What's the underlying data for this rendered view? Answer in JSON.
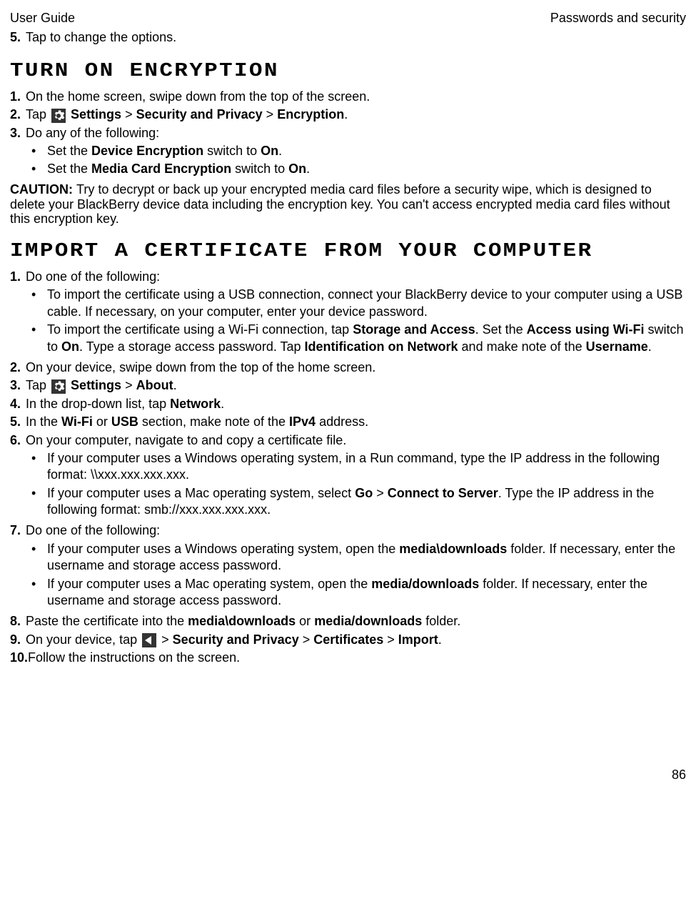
{
  "header_left": "User Guide",
  "header_right": "Passwords and security",
  "intro_step": {
    "num": "5.",
    "text": "Tap to change the options."
  },
  "section1": {
    "title": "Turn on encryption",
    "step1": {
      "num": "1.",
      "text": "On the home screen, swipe down from the top of the screen."
    },
    "step2": {
      "num": "2.",
      "prefix": "Tap ",
      "b1": "Settings",
      "sep1": " > ",
      "b2": "Security and Privacy",
      "sep2": " > ",
      "b3": "Encryption",
      "suffix": "."
    },
    "step3": {
      "num": "3.",
      "text": "Do any of the following:"
    },
    "bullets": {
      "b1": {
        "p1": "Set the ",
        "b1": "Device Encryption",
        "p2": " switch to ",
        "b2": "On",
        "p3": "."
      },
      "b2": {
        "p1": "Set the ",
        "b1": "Media Card Encryption",
        "p2": " switch to ",
        "b2": "On",
        "p3": "."
      }
    },
    "caution_label": "CAUTION: ",
    "caution_text": "Try to decrypt or back up your encrypted media card files before a security wipe, which is designed to delete your BlackBerry device data including the encryption key. You can't access encrypted media card files without this encryption key."
  },
  "section2": {
    "title": "Import a certificate from your computer",
    "step1": {
      "num": "1.",
      "text": "Do one of the following:"
    },
    "s1bullets": {
      "b1": "To import the certificate using a USB connection, connect your BlackBerry device to your computer using a USB cable. If necessary, on your computer, enter your device password.",
      "b2": {
        "p1": "To import the certificate using a Wi-Fi connection, tap ",
        "b1": "Storage and Access",
        "p2": ". Set the ",
        "b2": "Access using Wi-Fi",
        "p3": " switch to ",
        "b3": "On",
        "p4": ". Type a storage access password. Tap ",
        "b4": "Identification on Network",
        "p5": " and make note of the ",
        "b5": "Username",
        "p6": "."
      }
    },
    "step2": {
      "num": "2.",
      "text": "On your device, swipe down from the top of the home screen."
    },
    "step3": {
      "num": "3.",
      "prefix": "Tap ",
      "b1": "Settings",
      "sep1": " > ",
      "b2": "About",
      "suffix": "."
    },
    "step4": {
      "num": "4.",
      "p1": "In the drop-down list, tap ",
      "b1": "Network",
      "p2": "."
    },
    "step5": {
      "num": "5.",
      "p1": "In the ",
      "b1": "Wi-Fi",
      "p2": " or ",
      "b2": "USB",
      "p3": " section, make note of the ",
      "b3": "IPv4",
      "p4": " address."
    },
    "step6": {
      "num": "6.",
      "text": "On your computer, navigate to and copy a certificate file."
    },
    "s6bullets": {
      "b1": "If your computer uses a Windows operating system, in a Run command, type the IP address in the following format: \\\\xxx.xxx.xxx.xxx.",
      "b2": {
        "p1": "If your computer uses a Mac operating system, select ",
        "b1": "Go",
        "p2": " > ",
        "b2": "Connect to Server",
        "p3": ". Type the IP address in the following format: smb://xxx.xxx.xxx.xxx."
      }
    },
    "step7": {
      "num": "7.",
      "text": "Do one of the following:"
    },
    "s7bullets": {
      "b1": {
        "p1": "If your computer uses a Windows operating system, open the ",
        "b1": "media\\downloads",
        "p2": " folder. If necessary, enter the username and storage access password."
      },
      "b2": {
        "p1": "If your computer uses a Mac operating system, open the ",
        "b1": "media/downloads",
        "p2": " folder. If necessary, enter the username and storage access password."
      }
    },
    "step8": {
      "num": "8.",
      "p1": "Paste the certificate into the ",
      "b1": "media\\downloads",
      "p2": " or ",
      "b2": "media/downloads",
      "p3": " folder."
    },
    "step9": {
      "num": "9.",
      "p1": "On your device, tap ",
      "p2": " > ",
      "b1": "Security and Privacy",
      "p3": " > ",
      "b2": "Certificates",
      "p4": " > ",
      "b3": "Import",
      "p5": "."
    },
    "step10": {
      "num": "10.",
      "text": "Follow the instructions on the screen."
    }
  },
  "page_number": "86"
}
